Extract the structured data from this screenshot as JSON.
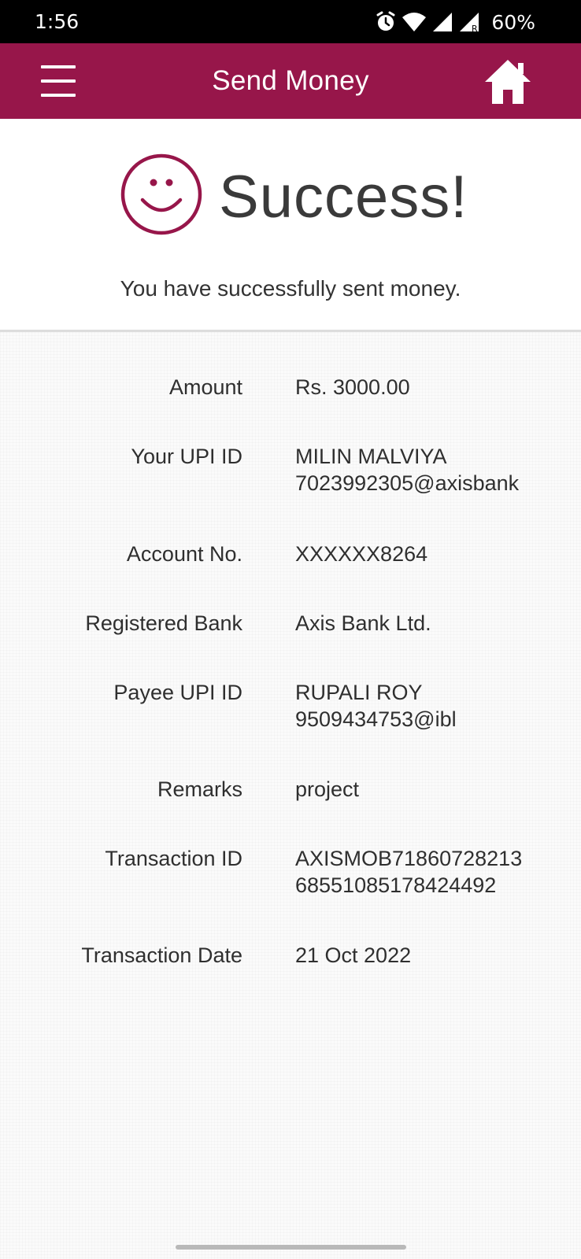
{
  "status_bar": {
    "time": "1:56",
    "battery": "60%",
    "icons": [
      "alarm-icon",
      "wifi-icon",
      "signal-icon",
      "signal-roaming-icon"
    ]
  },
  "app_bar": {
    "title": "Send Money",
    "menu_icon": "hamburger-menu-icon",
    "home_icon": "home-icon",
    "color": "#97164a"
  },
  "result": {
    "title": "Success!",
    "message": "You have successfully sent money.",
    "icon": "smiley-face-icon"
  },
  "details": {
    "amount_label": "Amount",
    "amount_value": "Rs. 3000.00",
    "your_upi_label": "Your UPI ID",
    "your_upi_name": "MILIN MALVIYA",
    "your_upi_id": "7023992305@axisbank",
    "account_label": "Account No.",
    "account_value": "XXXXXX8264",
    "bank_label": "Registered Bank",
    "bank_value": "Axis Bank Ltd.",
    "payee_label": "Payee UPI ID",
    "payee_name": "RUPALI ROY",
    "payee_id": "9509434753@ibl",
    "remarks_label": "Remarks",
    "remarks_value": "project",
    "txn_id_label": "Transaction ID",
    "txn_id_line1": "AXISMOB71860728213",
    "txn_id_line2": "68551085178424492",
    "txn_date_label": "Transaction Date",
    "txn_date_value": "21 Oct 2022"
  }
}
